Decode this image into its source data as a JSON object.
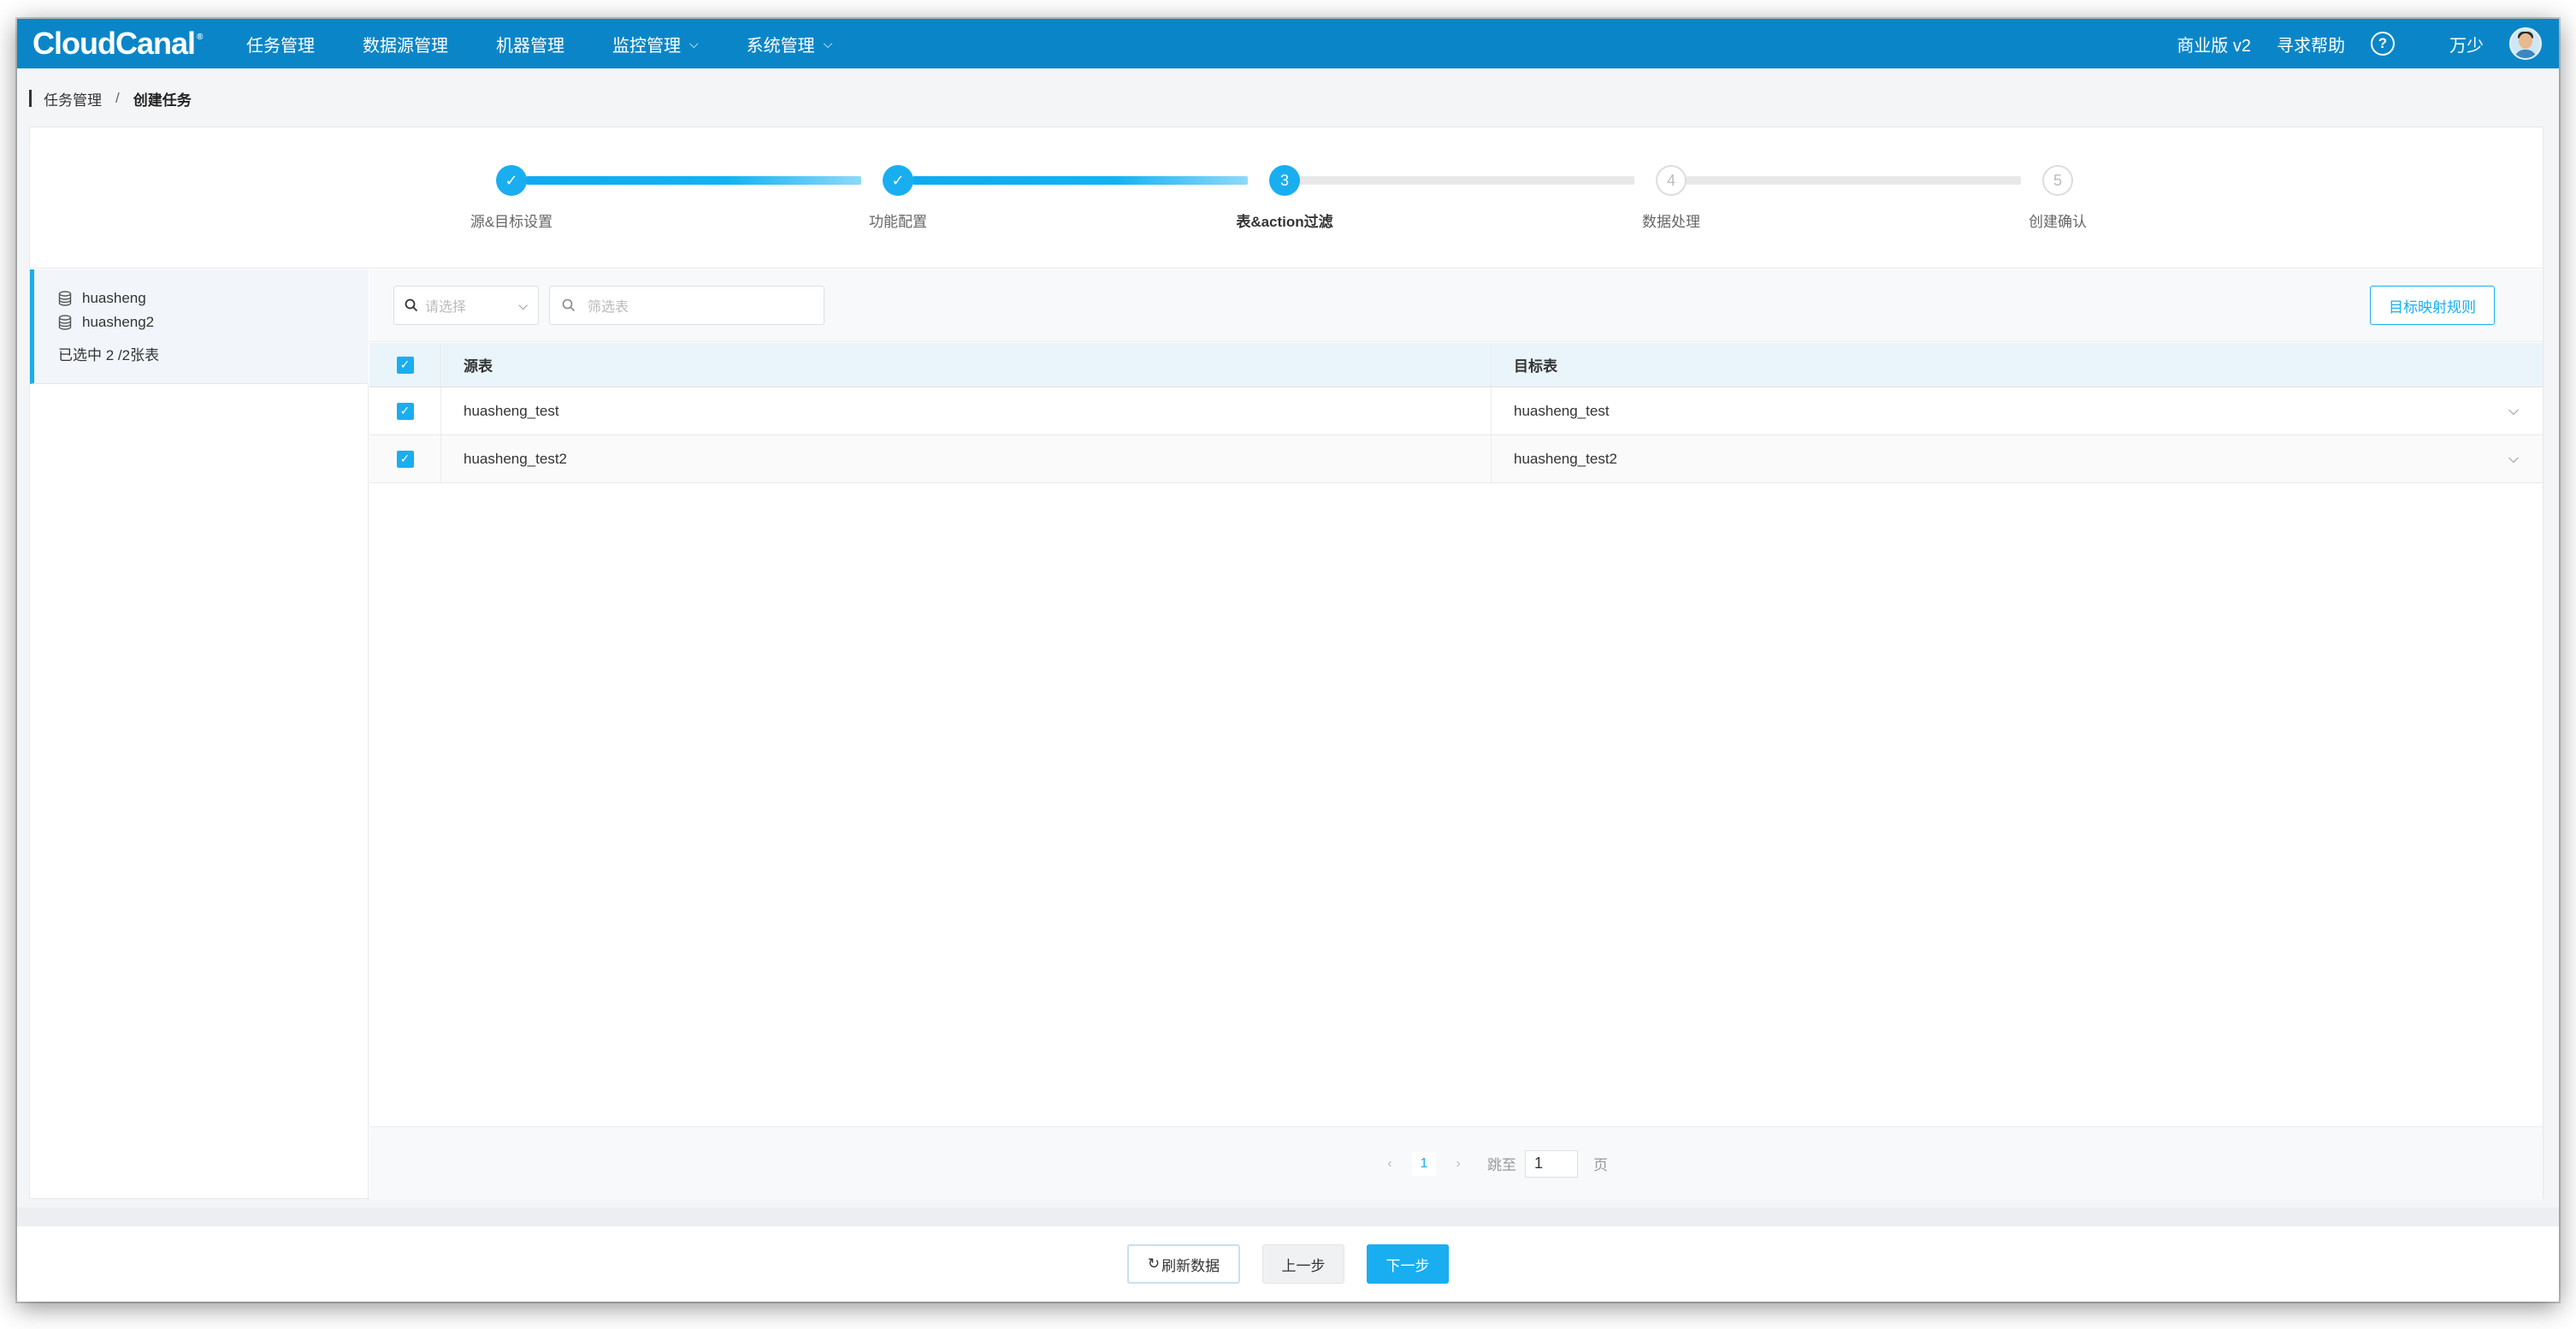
{
  "app": {
    "logo_text": "CloudCanal",
    "logo_mark": "®"
  },
  "nav": {
    "items": [
      {
        "label": "任务管理",
        "dropdown": false
      },
      {
        "label": "数据源管理",
        "dropdown": false
      },
      {
        "label": "机器管理",
        "dropdown": false
      },
      {
        "label": "监控管理",
        "dropdown": true
      },
      {
        "label": "系统管理",
        "dropdown": true
      }
    ],
    "edition": "商业版 v2",
    "help": "寻求帮助",
    "help_icon": "?",
    "username": "万少"
  },
  "breadcrumb": {
    "parent": "任务管理",
    "separator": "/",
    "current": "创建任务"
  },
  "steps": [
    {
      "index": "1",
      "label": "源&目标设置",
      "state": "done"
    },
    {
      "index": "2",
      "label": "功能配置",
      "state": "done"
    },
    {
      "index": "3",
      "label": "表&action过滤",
      "state": "active"
    },
    {
      "index": "4",
      "label": "数据处理",
      "state": "todo"
    },
    {
      "index": "5",
      "label": "创建确认",
      "state": "todo"
    }
  ],
  "left_panel": {
    "databases": [
      "huasheng",
      "huasheng2"
    ],
    "summary": "已选中 2 /2张表"
  },
  "toolbar": {
    "select_placeholder": "请选择",
    "filter_placeholder": "筛选表",
    "mapping_button": "目标映射规则"
  },
  "table": {
    "headers": {
      "source": "源表",
      "target": "目标表"
    },
    "rows": [
      {
        "checked": true,
        "source": "huasheng_test",
        "target": "huasheng_test"
      },
      {
        "checked": true,
        "source": "huasheng_test2",
        "target": "huasheng_test2"
      }
    ]
  },
  "pagination": {
    "current_page": "1",
    "jump_label": "跳至",
    "jump_value": "1",
    "page_suffix": "页"
  },
  "actions": {
    "refresh": "刷新数据",
    "prev": "上一步",
    "next": "下一步"
  },
  "colors": {
    "primary": "#19aef0",
    "navbar": "#0a86c8",
    "header_row": "#eaf4fb"
  }
}
